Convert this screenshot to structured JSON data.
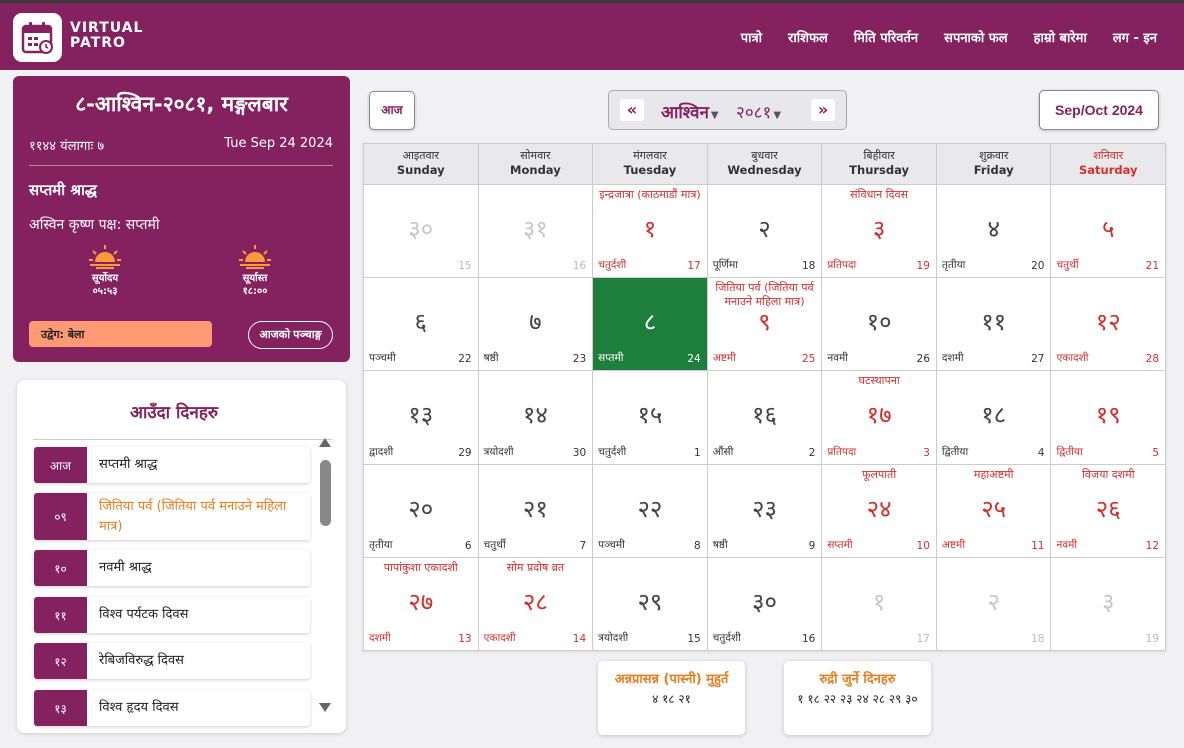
{
  "brand": {
    "line1": "VIRTUAL",
    "line2": "PATRO"
  },
  "nav": [
    "पात्रो",
    "राशिफल",
    "मिति परिवर्तन",
    "सपनाको फल",
    "हाम्रो बारेमा",
    "लग - इन"
  ],
  "today": {
    "date": "८-आश्विन-२०८१, मङ्गलबार",
    "nepal_sambat": "११४४  यंलागाः ७",
    "english_date": "Tue Sep 24 2024",
    "event": "सप्तमी श्राद्ध",
    "paksha": "अस्विन कृष्ण पक्ष:  सप्तमी",
    "sunrise_label": "सूर्योदय",
    "sunrise_time": "०५:५३",
    "sunset_label": "सूर्यास्त",
    "sunset_time": "१८:००",
    "udhweg": "उद्वेग: बेला",
    "panchang_button": "आजको पञ्चाङ्ग"
  },
  "upcoming": {
    "title": "आउँदा दिनहरु",
    "items": [
      {
        "badge": "आज",
        "text": "सप्तमी श्राद्ध",
        "highlight": false
      },
      {
        "badge": "०९",
        "text": "जितिया पर्व (जितिया पर्व मनाउने महिला मात्र)",
        "highlight": true
      },
      {
        "badge": "१०",
        "text": "नवमी श्राद्ध",
        "highlight": false
      },
      {
        "badge": "११",
        "text": "विश्व पर्यटक दिवस",
        "highlight": false
      },
      {
        "badge": "१२",
        "text": "रेबिजविरुद्ध दिवस",
        "highlight": false
      },
      {
        "badge": "१३",
        "text": "विश्व हृदय दिवस",
        "highlight": false
      }
    ]
  },
  "controls": {
    "today_button": "आज",
    "prev": "«",
    "next": "»",
    "month": "आश्विन",
    "year": "२०८१",
    "english_months": "Sep/Oct 2024"
  },
  "weekdays": [
    {
      "np": "आइतवार",
      "en": "Sunday"
    },
    {
      "np": "सोमवार",
      "en": "Monday"
    },
    {
      "np": "मंगलवार",
      "en": "Tuesday"
    },
    {
      "np": "बुधवार",
      "en": "Wednesday"
    },
    {
      "np": "बिहीवार",
      "en": "Thursday"
    },
    {
      "np": "शुक्रवार",
      "en": "Friday"
    },
    {
      "np": "शनिवार",
      "en": "Saturday"
    }
  ],
  "calendar": [
    [
      {
        "day": "३०",
        "tithi": "",
        "eng": "15",
        "event": "",
        "other": true
      },
      {
        "day": "३१",
        "tithi": "",
        "eng": "16",
        "event": "",
        "other": true
      },
      {
        "day": "१",
        "tithi": "चतुर्दशी",
        "eng": "17",
        "event": "इन्द्रजात्रा (काठमाडौं मात्र)",
        "holiday": true
      },
      {
        "day": "२",
        "tithi": "पूर्णिमा",
        "eng": "18",
        "event": ""
      },
      {
        "day": "३",
        "tithi": "प्रतिपदा",
        "eng": "19",
        "event": "संविधान दिवस",
        "holiday": true
      },
      {
        "day": "४",
        "tithi": "तृतीया",
        "eng": "20",
        "event": ""
      },
      {
        "day": "५",
        "tithi": "चतुर्थी",
        "eng": "21",
        "event": "",
        "holiday": true
      }
    ],
    [
      {
        "day": "६",
        "tithi": "पञ्चमी",
        "eng": "22",
        "event": ""
      },
      {
        "day": "७",
        "tithi": "षष्ठी",
        "eng": "23",
        "event": ""
      },
      {
        "day": "८",
        "tithi": "सप्तमी",
        "eng": "24",
        "event": "",
        "selected": true
      },
      {
        "day": "९",
        "tithi": "अष्टमी",
        "eng": "25",
        "event": "जितिया पर्व (जितिया पर्व मनाउने महिला मात्र)",
        "holiday": true
      },
      {
        "day": "१०",
        "tithi": "नवमी",
        "eng": "26",
        "event": ""
      },
      {
        "day": "११",
        "tithi": "दशमी",
        "eng": "27",
        "event": ""
      },
      {
        "day": "१२",
        "tithi": "एकादशी",
        "eng": "28",
        "event": "",
        "holiday": true
      }
    ],
    [
      {
        "day": "१३",
        "tithi": "द्वादशी",
        "eng": "29",
        "event": ""
      },
      {
        "day": "१४",
        "tithi": "त्रयोदशी",
        "eng": "30",
        "event": ""
      },
      {
        "day": "१५",
        "tithi": "चतुर्दशी",
        "eng": "1",
        "event": ""
      },
      {
        "day": "१६",
        "tithi": "औंसी",
        "eng": "2",
        "event": ""
      },
      {
        "day": "१७",
        "tithi": "प्रतिपदा",
        "eng": "3",
        "event": "घटस्थापना",
        "holiday": true
      },
      {
        "day": "१८",
        "tithi": "द्वितीया",
        "eng": "4",
        "event": ""
      },
      {
        "day": "१९",
        "tithi": "द्वितीया",
        "eng": "5",
        "event": "",
        "holiday": true
      }
    ],
    [
      {
        "day": "२०",
        "tithi": "तृतीया",
        "eng": "6",
        "event": ""
      },
      {
        "day": "२१",
        "tithi": "चतुर्थी",
        "eng": "7",
        "event": ""
      },
      {
        "day": "२२",
        "tithi": "पञ्चमी",
        "eng": "8",
        "event": ""
      },
      {
        "day": "२३",
        "tithi": "षष्ठी",
        "eng": "9",
        "event": ""
      },
      {
        "day": "२४",
        "tithi": "सप्तमी",
        "eng": "10",
        "event": "फूलपाती",
        "holiday": true
      },
      {
        "day": "२५",
        "tithi": "अष्टमी",
        "eng": "11",
        "event": "महाअष्टमी",
        "holiday": true
      },
      {
        "day": "२६",
        "tithi": "नवमी",
        "eng": "12",
        "event": "विजया दशमी",
        "holiday": true
      }
    ],
    [
      {
        "day": "२७",
        "tithi": "दशमी",
        "eng": "13",
        "event": "पापांकुशा एकादशी",
        "holiday": true
      },
      {
        "day": "२८",
        "tithi": "एकादशी",
        "eng": "14",
        "event": "सोम प्रदोष व्रत",
        "holiday": true
      },
      {
        "day": "२९",
        "tithi": "त्रयोदशी",
        "eng": "15",
        "event": ""
      },
      {
        "day": "३०",
        "tithi": "चतुर्दशी",
        "eng": "16",
        "event": ""
      },
      {
        "day": "१",
        "tithi": "",
        "eng": "17",
        "event": "",
        "other": true
      },
      {
        "day": "२",
        "tithi": "",
        "eng": "18",
        "event": "",
        "other": true
      },
      {
        "day": "३",
        "tithi": "",
        "eng": "19",
        "event": "",
        "other": true
      }
    ]
  ],
  "bottom": {
    "annaprashan_title": "अन्नप्रासन्न (पास्नी) मुहुर्त",
    "annaprashan_days": "४ १८ २१",
    "rudri_title": "रुद्री जुर्ने दिनहरु",
    "rudri_days": "१ १८ २२ २३ २४ २८ २९ ३०"
  },
  "colors": {
    "brand": "#84225f",
    "holiday": "#d32f2f",
    "selected": "#1e7f3c",
    "highlight": "#e67e22"
  }
}
